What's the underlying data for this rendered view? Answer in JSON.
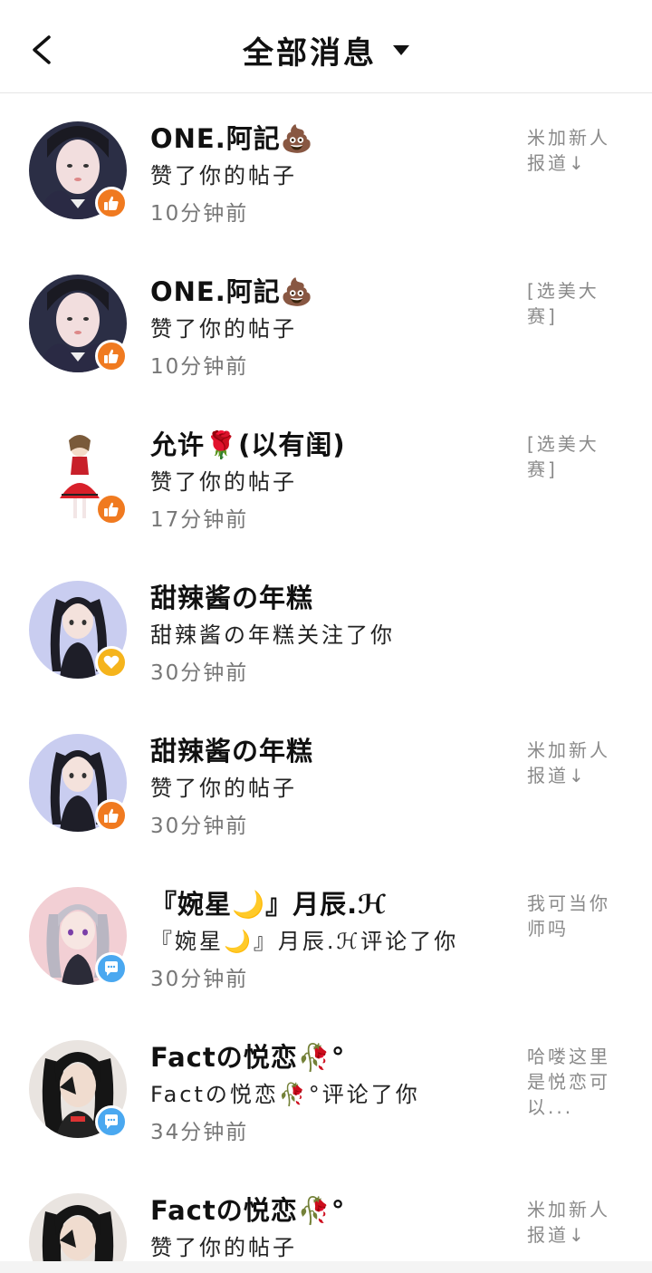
{
  "header": {
    "title": "全部消息",
    "back_icon": "chevron-left-icon",
    "dropdown_icon": "caret-down-icon"
  },
  "colors": {
    "like_badge": "#f07a20",
    "follow_badge": "#f5b41c",
    "comment_badge": "#4aa8f0"
  },
  "messages": [
    {
      "name": "ONE.阿記💩",
      "action": "赞了你的帖子",
      "time": "10分钟前",
      "preview": "米加新人报道↓",
      "badge": "like",
      "avatar": "avatar-dark-hair"
    },
    {
      "name": "ONE.阿記💩",
      "action": "赞了你的帖子",
      "time": "10分钟前",
      "preview": "[选美大赛]",
      "badge": "like",
      "avatar": "avatar-dark-hair"
    },
    {
      "name": "允许🌹(以有闺)",
      "action": "赞了你的帖子",
      "time": "17分钟前",
      "preview": "[选美大赛]",
      "badge": "like",
      "avatar": "avatar-red-dress"
    },
    {
      "name": "甜辣酱の年糕",
      "action": "甜辣酱の年糕关注了你",
      "time": "30分钟前",
      "preview": "",
      "badge": "follow",
      "avatar": "avatar-twin-tails"
    },
    {
      "name": "甜辣酱の年糕",
      "action": "赞了你的帖子",
      "time": "30分钟前",
      "preview": "米加新人报道↓",
      "badge": "like",
      "avatar": "avatar-twin-tails"
    },
    {
      "name": "『婉星🌙』月辰.ℋ",
      "action": "『婉星🌙』月辰.ℋ评论了你",
      "time": "30分钟前",
      "preview": "我可当你师吗",
      "badge": "comment",
      "avatar": "avatar-silver-hair"
    },
    {
      "name": "Factの悦恋🥀°",
      "action": "Factの悦恋🥀°评论了你",
      "time": "34分钟前",
      "preview": "哈喽这里是悦恋可以...",
      "badge": "comment",
      "avatar": "avatar-black-hair"
    },
    {
      "name": "Factの悦恋🥀°",
      "action": "赞了你的帖子",
      "time": "",
      "preview": "米加新人报道↓",
      "badge": "like",
      "avatar": "avatar-black-hair"
    }
  ]
}
